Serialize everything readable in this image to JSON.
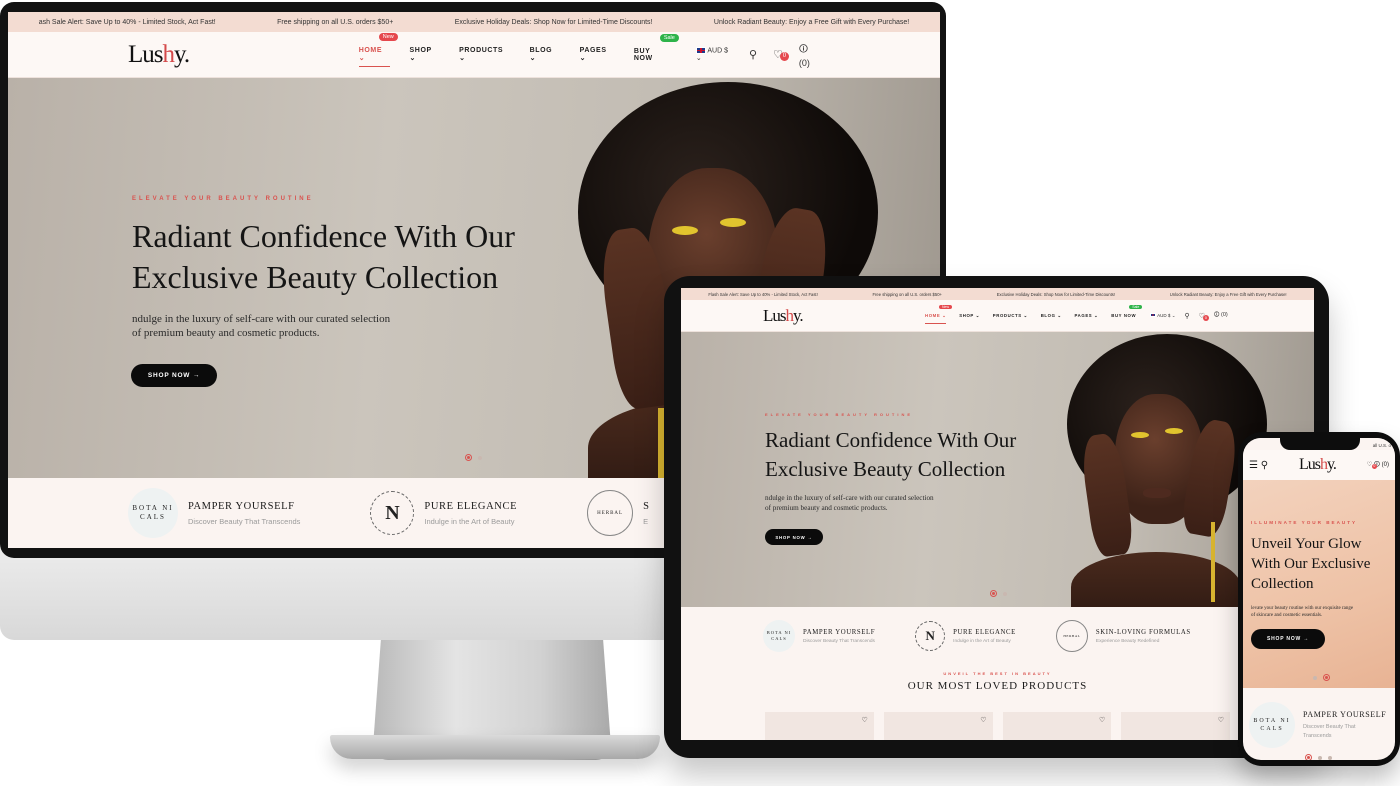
{
  "announcements": [
    "ash Sale Alert: Save Up to 40% - Limited Stock, Act Fast!",
    "Free shipping on all U.S. orders $50+",
    "Exclusive Holiday Deals: Shop Now for Limited-Time Discounts!",
    "Unlock Radiant Beauty: Enjoy a Free Gift with Every Purchase!"
  ],
  "tablet_announcements": [
    "Flash Sale Alert: Save Up to 40% - Limited Stock, Act Fast!",
    "Free shipping on all U.S. orders $50+",
    "Exclusive Holiday Deals: Shop Now for Limited-Time Discounts!",
    "Unlock Radiant Beauty: Enjoy a Free Gift with Every Purchase!"
  ],
  "logo": {
    "prefix": "Lus",
    "h": "h",
    "suffix": "y."
  },
  "nav": {
    "home": "HOME",
    "home_badge": "New",
    "shop": "SHOP",
    "products": "PRODUCTS",
    "blog": "BLOG",
    "pages": "PAGES",
    "buy_now": "BUY NOW",
    "buy_badge": "Sale",
    "currency": "AUD $",
    "wishlist_count": "0",
    "cart_count": "(0)"
  },
  "hero": {
    "kicker": "ELEVATE YOUR BEAUTY ROUTINE",
    "title_line1": "Radiant Confidence With Our",
    "title_line2": "Exclusive Beauty Collection",
    "copy_line1": "ndulge in the luxury of self-care with our curated selection",
    "copy_line2": "of premium beauty and cosmetic products.",
    "button": "SHOP NOW →"
  },
  "features": [
    {
      "title": "PAMPER YOURSELF",
      "sub": "Discover Beauty That Transcends",
      "logo": "BOTA NI CALS"
    },
    {
      "title": "PURE ELEGANCE",
      "sub": "Indulge in the Art of Beauty",
      "logo": "N"
    },
    {
      "title": "SKIN-LOVING FORMULAS",
      "sub": "Experience Beauty Redefined",
      "logo": "HERBAL"
    }
  ],
  "monitor_feature3_cut": "S",
  "monitor_feature3_sub_cut": "E",
  "section": {
    "kicker": "UNVEIL THE BEST IN BEAUTY",
    "title": "OUR MOST LOVED PRODUCTS"
  },
  "phone": {
    "announce_cut": "all U.S. o",
    "cart": "(0)",
    "wishlist": "0",
    "kicker": "ILLUMINATE YOUR BEAUTY",
    "title_line1": "Unveil Your Glow",
    "title_line2": "With Our Exclusive",
    "title_line3": "Collection",
    "copy_line1": "levate your beauty routine with our exquisite range",
    "copy_line2": "of skincare and cosmetic essentials.",
    "button": "SHOP NOW →",
    "feature_title": "PAMPER YOURSELF",
    "feature_sub_line1": "Discover Beauty That",
    "feature_sub_line2": "Transcends",
    "feature_logo": "BOTA NI CALS"
  },
  "colors": {
    "accent": "#d9534f",
    "announce_bg": "#f3dcd2",
    "page_bg": "#fbf4f1",
    "button": "#0b0b0b"
  }
}
